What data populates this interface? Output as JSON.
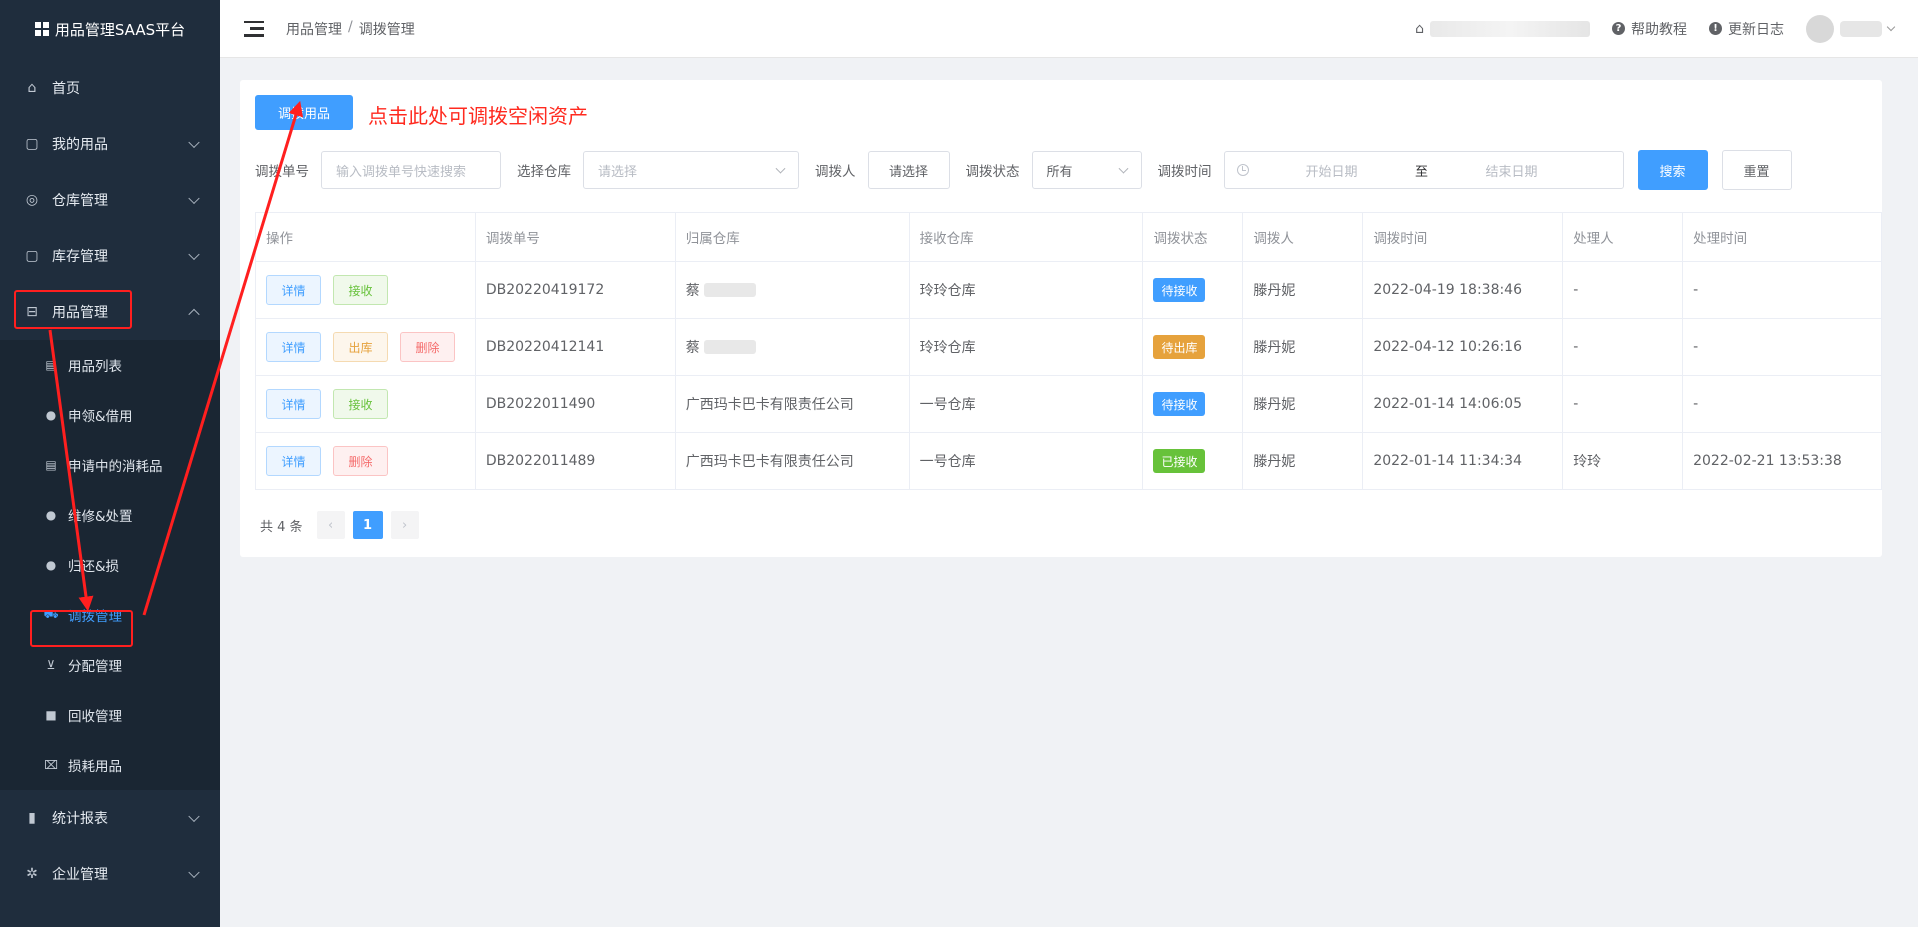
{
  "app": {
    "title": "用品管理SAAS平台"
  },
  "sidebar": {
    "items": [
      {
        "label": "首页",
        "icon": "home-icon"
      },
      {
        "label": "我的用品",
        "icon": "bag-icon"
      },
      {
        "label": "仓库管理",
        "icon": "database-icon"
      },
      {
        "label": "库存管理",
        "icon": "bag-icon"
      },
      {
        "label": "用品管理",
        "icon": "inbox-icon"
      },
      {
        "label": "统计报表",
        "icon": "bar-chart-icon"
      },
      {
        "label": "企业管理",
        "icon": "gear-icon"
      }
    ],
    "sub_items": [
      {
        "label": "用品列表",
        "icon": "clipboard-icon"
      },
      {
        "label": "申领&借用",
        "icon": "user-icon"
      },
      {
        "label": "申请中的消耗品",
        "icon": "clipboard-icon"
      },
      {
        "label": "维修&处置",
        "icon": "user-icon"
      },
      {
        "label": "归还&损",
        "icon": "user-icon"
      },
      {
        "label": "调拨管理",
        "icon": "truck-icon"
      },
      {
        "label": "分配管理",
        "icon": "cart-icon"
      },
      {
        "label": "回收管理",
        "icon": "box-icon"
      },
      {
        "label": "损耗用品",
        "icon": "trash-icon"
      }
    ]
  },
  "header": {
    "breadcrumb": [
      "用品管理",
      "调拨管理"
    ],
    "help_label": "帮助教程",
    "changelog_label": "更新日志"
  },
  "main": {
    "top_button": "调拨用品",
    "annotation": "点击此处可调拨空闲资产",
    "filters": {
      "order_label": "调拨单号",
      "order_placeholder": "输入调拨单号快速搜索",
      "warehouse_label": "选择仓库",
      "warehouse_placeholder": "请选择",
      "person_label": "调拨人",
      "person_button": "请选择",
      "status_label": "调拨状态",
      "status_value": "所有",
      "time_label": "调拨时间",
      "start_placeholder": "开始日期",
      "range_sep": "至",
      "end_placeholder": "结束日期",
      "search_button": "搜索",
      "reset_button": "重置"
    },
    "table": {
      "headers": [
        "操作",
        "调拨单号",
        "归属仓库",
        "接收仓库",
        "调拨状态",
        "调拨人",
        "调拨时间",
        "处理人",
        "处理时间"
      ],
      "rows": [
        {
          "actions": [
            "详情",
            "接收"
          ],
          "order": "DB20220419172",
          "from": "蔡",
          "to": "玲玲仓库",
          "status": "待接收",
          "status_color": "#409eff",
          "person": "滕丹妮",
          "time": "2022-04-19 18:38:46",
          "handler": "-",
          "handle_time": "-"
        },
        {
          "actions": [
            "详情",
            "出库",
            "删除"
          ],
          "order": "DB20220412141",
          "from": "蔡",
          "to": "玲玲仓库",
          "status": "待出库",
          "status_color": "#e6a23c",
          "person": "滕丹妮",
          "time": "2022-04-12 10:26:16",
          "handler": "-",
          "handle_time": "-"
        },
        {
          "actions": [
            "详情",
            "接收"
          ],
          "order": "DB2022011490",
          "from": "广西玛卡巴卡有限责任公司",
          "to": "一号仓库",
          "status": "待接收",
          "status_color": "#409eff",
          "person": "滕丹妮",
          "time": "2022-01-14 14:06:05",
          "handler": "-",
          "handle_time": "-"
        },
        {
          "actions": [
            "详情",
            "删除"
          ],
          "order": "DB2022011489",
          "from": "广西玛卡巴卡有限责任公司",
          "to": "一号仓库",
          "status": "已接收",
          "status_color": "#67c23a",
          "person": "滕丹妮",
          "time": "2022-01-14 11:34:34",
          "handler": "玲玲",
          "handle_time": "2022-02-21 13:53:38"
        }
      ]
    },
    "pagination": {
      "total_text": "共 4 条",
      "current": "1",
      "prev": "‹",
      "next": "›"
    }
  },
  "colors": {
    "primary": "#409eff",
    "sidebar_bg": "#1f2d3d",
    "annotation": "#ff2a1f"
  }
}
